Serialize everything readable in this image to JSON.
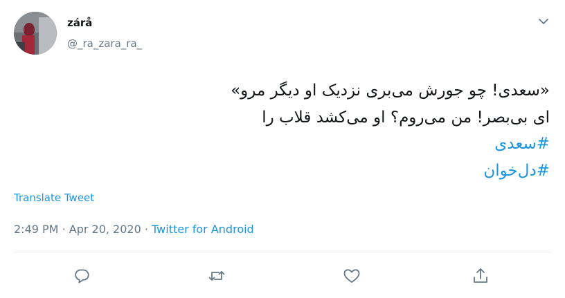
{
  "author": {
    "display_name": "zárå",
    "handle": "@_ra_zara_ra_"
  },
  "tweet": {
    "lines": [
      "«سعدی! چو جورش می‌بری نزدیک او دیگر مرو»",
      "ای بی‌بصر! من می‌روم؟ او می‌کشد قلاب را"
    ],
    "hashtags": [
      "#سعدی",
      "#دل‌خوان"
    ]
  },
  "translate_label": "Translate Tweet",
  "meta": {
    "time": "2:49 PM",
    "separator": "·",
    "date": "Apr 20, 2020",
    "source": "Twitter for Android"
  },
  "icons": {
    "menu": "chevron-down-icon",
    "reply": "reply-icon",
    "retweet": "retweet-icon",
    "like": "like-icon",
    "share": "share-icon"
  },
  "colors": {
    "link": "#1b95e0",
    "secondary_text": "#657786",
    "primary_text": "#14171a",
    "divider": "#e6ecf0"
  }
}
